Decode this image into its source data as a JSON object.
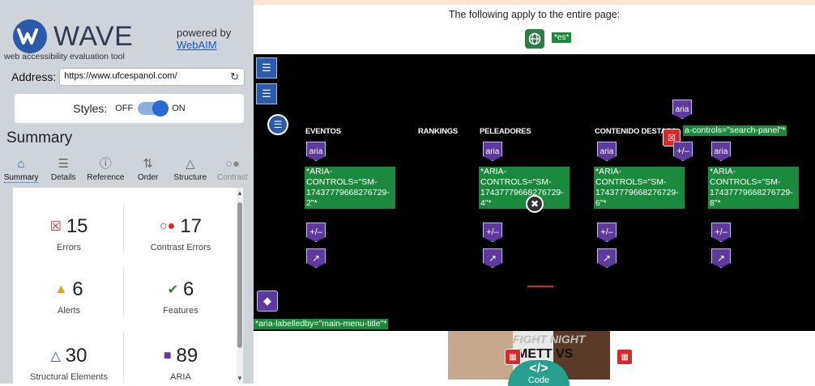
{
  "wave": {
    "logo_text": "WAVE",
    "tagline": "web accessibility evaluation tool",
    "powered_by": "powered by",
    "powered_link": "WebAIM"
  },
  "address": {
    "label": "Address:",
    "value": "https://www.ufcespanol.com/"
  },
  "styles": {
    "label": "Styles:",
    "off": "OFF",
    "on": "ON"
  },
  "summary": {
    "title": "Summary",
    "tabs": [
      {
        "label": "Summary",
        "icon": "home-icon"
      },
      {
        "label": "Details",
        "icon": "list-icon"
      },
      {
        "label": "Reference",
        "icon": "info-icon"
      },
      {
        "label": "Order",
        "icon": "order-icon"
      },
      {
        "label": "Structure",
        "icon": "structure-icon"
      },
      {
        "label": "Contrast",
        "icon": "contrast-icon"
      }
    ],
    "stats": [
      {
        "value": "15",
        "label": "Errors",
        "color": "#d32b2b"
      },
      {
        "value": "17",
        "label": "Contrast Errors",
        "color": "#d32b2b"
      },
      {
        "value": "6",
        "label": "Alerts",
        "color": "#e3a10b"
      },
      {
        "value": "6",
        "label": "Features",
        "color": "#2e7d42"
      },
      {
        "value": "30",
        "label": "Structural Elements",
        "color": "#2a5aa8"
      },
      {
        "value": "89",
        "label": "ARIA",
        "color": "#5c3a9e"
      }
    ]
  },
  "main": {
    "apply_text": "The following apply to the entire page:",
    "lang_code": "*es*",
    "nav": [
      "EVENTOS",
      "RANKINGS",
      "PELEADORES",
      "CONTENIDO DESTACA"
    ],
    "aria_label": "aria",
    "pm_label": "+/–",
    "aria_controls": [
      "*ARIA-CONTROLS=\"SM-17437779668276729-2\"*",
      "*ARIA-CONTROLS=\"SM-17437779668276729-4\"*",
      "*ARIA-CONTROLS=\"SM-17437779668276729-6\"*",
      "*ARIA-CONTROLS=\"SM-17437779668276729-8\"*"
    ],
    "search_controls": "a-controls=\"search-panel\"*",
    "labelledby": "*aria-labelledby=\"main-menu-title\"*",
    "poster_brand": "FIGHT NIGHT",
    "poster_vs": "METT VS",
    "code_symbol": "</>",
    "code_label": "Code"
  }
}
